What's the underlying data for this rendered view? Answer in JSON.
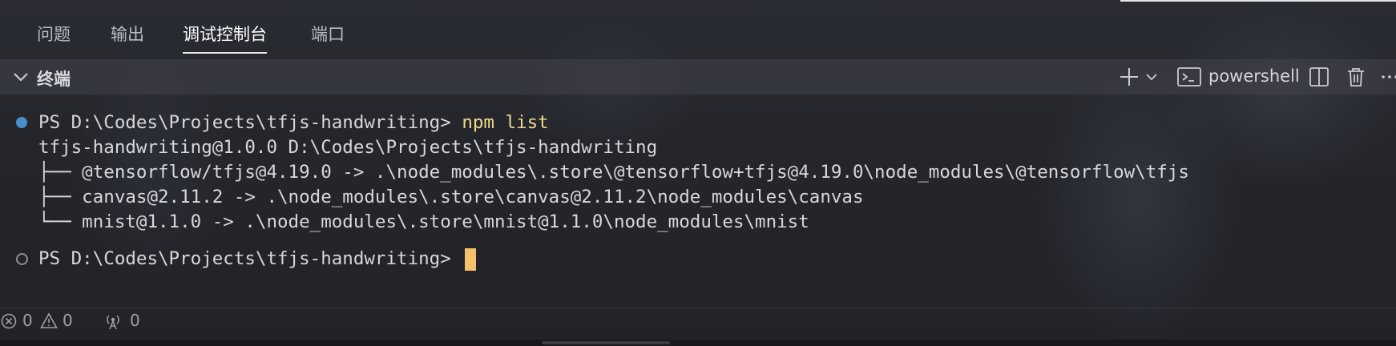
{
  "panel_tabs": [
    {
      "label": "问题",
      "active": false
    },
    {
      "label": "输出",
      "active": false
    },
    {
      "label": "调试控制台",
      "active": true
    },
    {
      "label": "端口",
      "active": false
    }
  ],
  "terminal_header": {
    "title": "终端",
    "shell": "powershell",
    "icons": [
      "chevron-down-icon",
      "plus-icon",
      "chevron-down-icon",
      "terminal-icon",
      "split-icon",
      "trash-icon",
      "more-icon"
    ]
  },
  "terminal": {
    "lines": [
      {
        "prompt": "PS D:\\Codes\\Projects\\tfjs-handwriting> ",
        "command": "npm list"
      },
      {
        "text": "tfjs-handwriting@1.0.0 D:\\Codes\\Projects\\tfjs-handwriting"
      },
      {
        "text": "├── @tensorflow/tfjs@4.19.0 -> .\\node_modules\\.store\\@tensorflow+tfjs@4.19.0\\node_modules\\@tensorflow\\tfjs"
      },
      {
        "text": "├── canvas@2.11.2 -> .\\node_modules\\.store\\canvas@2.11.2\\node_modules\\canvas"
      },
      {
        "text": "└── mnist@1.1.0 -> .\\node_modules\\.store\\mnist@1.1.0\\node_modules\\mnist"
      },
      {
        "prompt": "PS D:\\Codes\\Projects\\tfjs-handwriting> "
      }
    ]
  },
  "status_bar": {
    "errors": "0",
    "warnings": "0",
    "ports": "0"
  },
  "colors": {
    "command": "#f0d98a",
    "cursor": "#f5c26b",
    "prompt_dot_success": "#4a90c8"
  }
}
